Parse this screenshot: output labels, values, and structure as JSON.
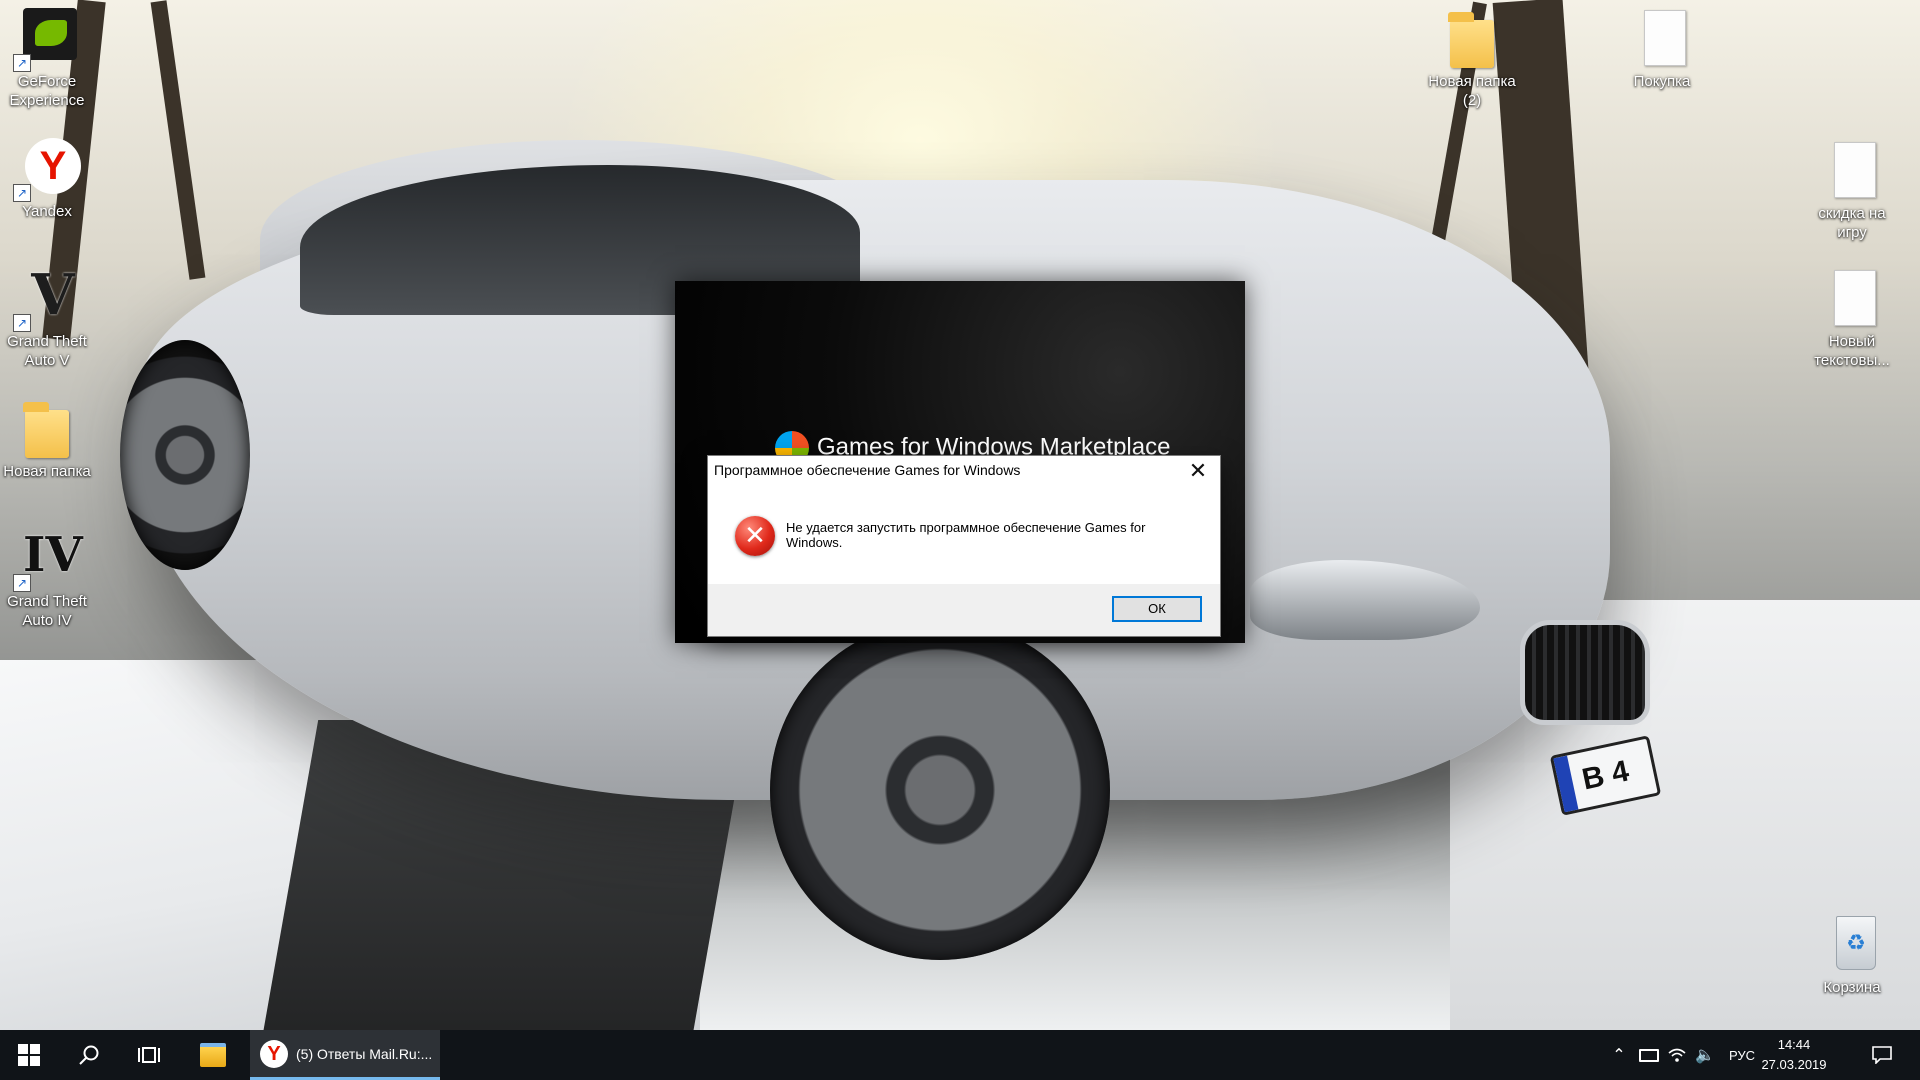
{
  "desktop": {
    "icons_left": [
      {
        "label": "GeForce Experience",
        "icon": "nvidia-icon"
      },
      {
        "label": "Yandex",
        "icon": "yandex-icon"
      },
      {
        "label": "Grand Theft Auto V",
        "icon": "gta5-icon"
      },
      {
        "label": "Новая папка",
        "icon": "folder-icon"
      },
      {
        "label": "Grand Theft Auto IV",
        "icon": "gta4-icon"
      }
    ],
    "icons_right": [
      {
        "label": "Новая папка (2)",
        "icon": "folder-icon"
      },
      {
        "label": "Покупка",
        "icon": "text-file-icon"
      },
      {
        "label": "скидка на игру",
        "icon": "text-file-icon"
      },
      {
        "label": "Новый текстовы...",
        "icon": "text-file-icon"
      },
      {
        "label": "Корзина",
        "icon": "recycle-bin-icon"
      }
    ],
    "wallpaper_plate": "B 4"
  },
  "gfw_window": {
    "logo_text": "Games for Windows Marketplace"
  },
  "dialog": {
    "title": "Программное обеспечение Games for Windows",
    "message": "Не удается запустить программное обеспечение Games for Windows.",
    "ok_label": "ОК",
    "close_glyph": "✕"
  },
  "taskbar": {
    "active_task": "(5) Ответы Mail.Ru:...",
    "language": "РУС",
    "time": "14:44",
    "date": "27.03.2019"
  }
}
